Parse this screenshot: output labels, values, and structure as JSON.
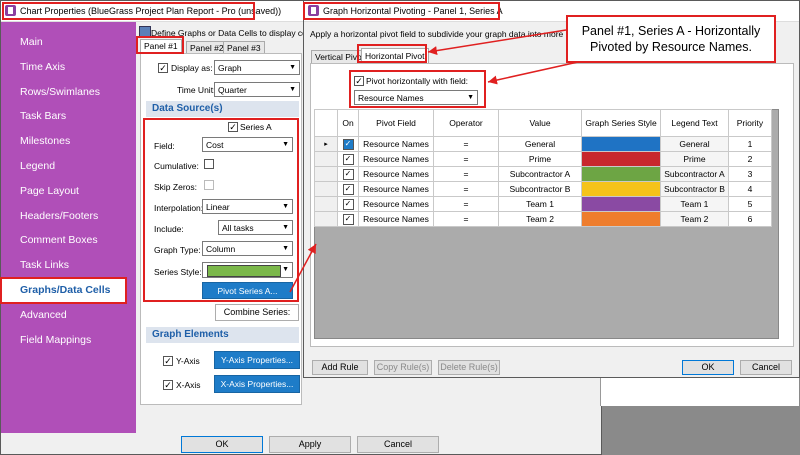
{
  "main_window": {
    "title": "Chart Properties (BlueGrass Project Plan Report - Pro (unsaved))",
    "nav_items": [
      "Main",
      "Time Axis",
      "Rows/Swimlanes",
      "Task Bars",
      "Milestones",
      "Legend",
      "Page Layout",
      "Headers/Footers",
      "Comment Boxes",
      "Task Links",
      "Graphs/Data Cells",
      "Advanced",
      "Field Mappings"
    ],
    "selected_nav": "Graphs/Data Cells",
    "description": "Define Graphs or Data Cells to display cost,",
    "panel_tabs": [
      "Panel #1",
      "Panel #2",
      "Panel #3"
    ],
    "display_as_label": "Display as:",
    "display_as_value": "Graph",
    "time_unit_label": "Time Unit:",
    "time_unit_value": "Quarter",
    "data_sources_header": "Data Source(s)",
    "series_tab": "Series A",
    "field_label": "Field:",
    "field_value": "Cost",
    "cumulative_label": "Cumulative:",
    "skip_zeros_label": "Skip Zeros:",
    "interpolation_label": "Interpolation:",
    "interpolation_value": "Linear",
    "include_label": "Include:",
    "include_value": "All tasks",
    "graph_type_label": "Graph Type:",
    "graph_type_value": "Column",
    "series_style_label": "Series Style:",
    "series_style_color": "#7bb84a",
    "pivot_series_button": "Pivot Series A...",
    "combine_series_button": "Combine Series:",
    "graph_elements_header": "Graph Elements",
    "y_axis_label": "Y-Axis",
    "y_axis_button": "Y-Axis Properties...",
    "x_axis_label": "X-Axis",
    "x_axis_button": "X-Axis Properties...",
    "ok_button": "OK",
    "apply_button": "Apply",
    "cancel_button": "Cancel"
  },
  "pivot_dialog": {
    "title": "Graph Horizontal Pivoting - Panel 1, Series A",
    "description": "Apply a horizontal pivot field to subdivide your graph data into more granula",
    "tabs": [
      "Vertical Pivot",
      "Horizontal Pivot"
    ],
    "active_tab": "Horizontal Pivot",
    "pivot_checkbox_label": "Pivot horizontally with field:",
    "pivot_field_value": "Resource Names",
    "columns": [
      "On",
      "Pivot Field",
      "Operator",
      "Value",
      "Graph Series Style",
      "Legend Text",
      "Priority"
    ],
    "rows": [
      {
        "on": true,
        "field": "Resource Names",
        "operator": "=",
        "value": "General",
        "color": "#1f73c4",
        "legend": "General",
        "priority": "1"
      },
      {
        "on": true,
        "field": "Resource Names",
        "operator": "=",
        "value": "Prime",
        "color": "#c8282d",
        "legend": "Prime",
        "priority": "2"
      },
      {
        "on": true,
        "field": "Resource Names",
        "operator": "=",
        "value": "Subcontractor A",
        "color": "#6da544",
        "legend": "Subcontractor A",
        "priority": "3"
      },
      {
        "on": true,
        "field": "Resource Names",
        "operator": "=",
        "value": "Subcontractor B",
        "color": "#f5c31a",
        "legend": "Subcontractor B",
        "priority": "4"
      },
      {
        "on": true,
        "field": "Resource Names",
        "operator": "=",
        "value": "Team 1",
        "color": "#8a4aa3",
        "legend": "Team 1",
        "priority": "5"
      },
      {
        "on": true,
        "field": "Resource Names",
        "operator": "=",
        "value": "Team 2",
        "color": "#ee7d2d",
        "legend": "Team 2",
        "priority": "6"
      }
    ],
    "add_rule": "Add Rule",
    "copy_rules": "Copy Rule(s)",
    "delete_rules": "Delete Rule(s)",
    "ok_button": "OK",
    "cancel_button": "Cancel"
  },
  "callout": {
    "text": "Panel #1, Series A - Horizontally Pivoted by Resource Names."
  },
  "colors": {
    "sidebar": "#b04fb8",
    "selected_nav_bg": "#ffffff",
    "annotation_red": "#e02020",
    "button_blue": "#1e7cc8"
  }
}
